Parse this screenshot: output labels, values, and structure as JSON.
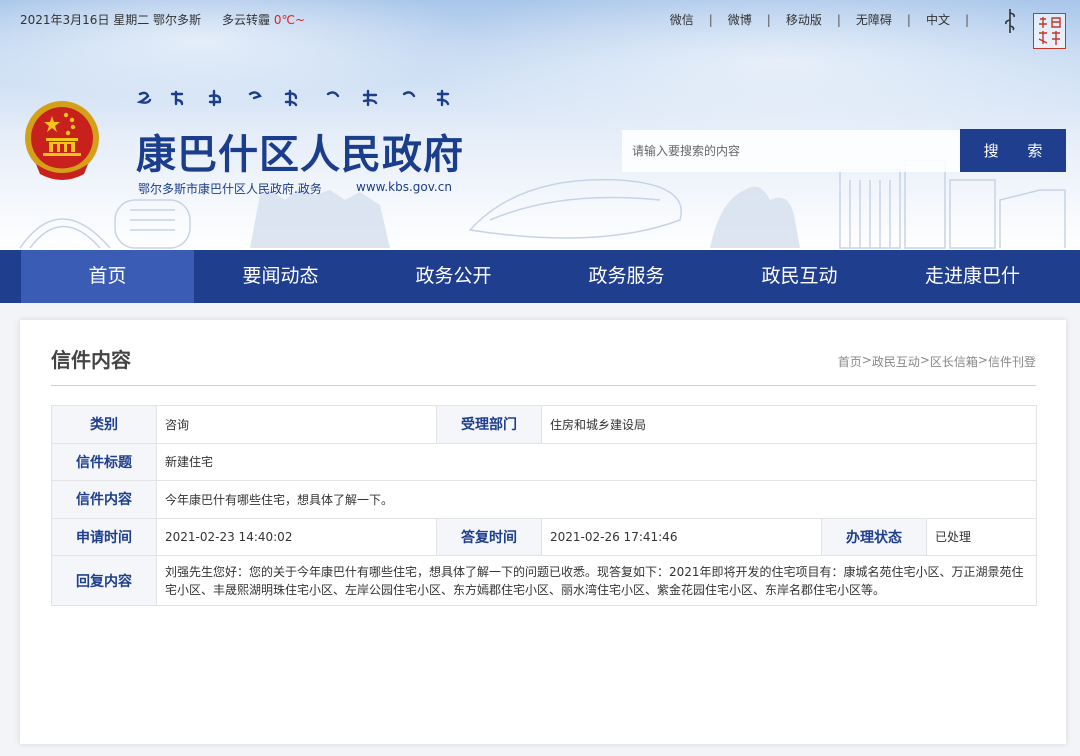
{
  "topbar": {
    "date": "2021年3月16日 星期二",
    "city": "鄂尔多斯",
    "weather": "多云转霾",
    "temperature": "0℃~",
    "links": [
      "微信",
      "微博",
      "移动版",
      "无障碍",
      "中文"
    ],
    "seal_text": "鄂尔多斯"
  },
  "header": {
    "site_title": "康巴什区人民政府",
    "site_subtitle": "鄂尔多斯市康巴什区人民政府.政务",
    "site_url": "www.kbs.gov.cn",
    "search_placeholder": "请输入要搜索的内容",
    "search_button": "搜 索"
  },
  "nav": {
    "items": [
      "首页",
      "要闻动态",
      "政务公开",
      "政务服务",
      "政民互动",
      "走进康巴什"
    ],
    "active_index": 0
  },
  "content": {
    "title": "信件内容",
    "breadcrumb": [
      "首页",
      "政民互动",
      "区长信箱",
      "信件刊登"
    ],
    "breadcrumb_sep": ">",
    "table": {
      "category_label": "类别",
      "category_value": "咨询",
      "dept_label": "受理部门",
      "dept_value": "住房和城乡建设局",
      "subject_label": "信件标题",
      "subject_value": "新建住宅",
      "body_label": "信件内容",
      "body_value": "今年康巴什有哪些住宅，想具体了解一下。",
      "apply_time_label": "申请时间",
      "apply_time_value": "2021-02-23 14:40:02",
      "reply_time_label": "答复时间",
      "reply_time_value": "2021-02-26 17:41:46",
      "status_label": "办理状态",
      "status_value": "已处理",
      "reply_label": "回复内容",
      "reply_value": "刘强先生您好：您的关于今年康巴什有哪些住宅，想具体了解一下的问题已收悉。现答复如下：2021年即将开发的住宅项目有：康城名苑住宅小区、万正湖景苑住宅小区、丰晟熙湖明珠住宅小区、左岸公园住宅小区、东方嫣郡住宅小区、丽水湾住宅小区、紫金花园住宅小区、东岸名郡住宅小区等。"
    }
  },
  "colors": {
    "brand_blue": "#1f3f8e",
    "nav_active": "#3a5cb5",
    "temperature": "#e02020"
  }
}
